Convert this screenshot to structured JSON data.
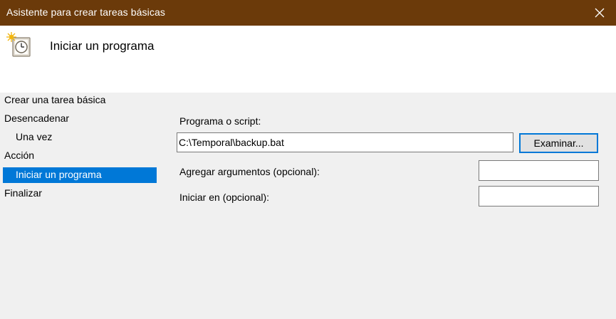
{
  "window": {
    "title": "Asistente para crear tareas básicas"
  },
  "header": {
    "title": "Iniciar un programa",
    "icon": "scheduled-task-clock-icon"
  },
  "nav": {
    "items": [
      {
        "label": "Crear una tarea básica"
      },
      {
        "label": "Desencadenar"
      },
      {
        "label": "Una vez"
      },
      {
        "label": "Acción"
      },
      {
        "label": "Iniciar un programa",
        "selected": true
      },
      {
        "label": "Finalizar"
      }
    ]
  },
  "form": {
    "program_label": "Programa o script:",
    "program_value": "C:\\Temporal\\backup.bat",
    "browse_label": "Examinar...",
    "args_label": "Agregar argumentos (opcional):",
    "args_value": "",
    "start_in_label": "Iniciar en (opcional):",
    "start_in_value": ""
  },
  "colors": {
    "titlebar": "#6b3a0a",
    "selection": "#0078d7",
    "background": "#f0f0f0"
  }
}
